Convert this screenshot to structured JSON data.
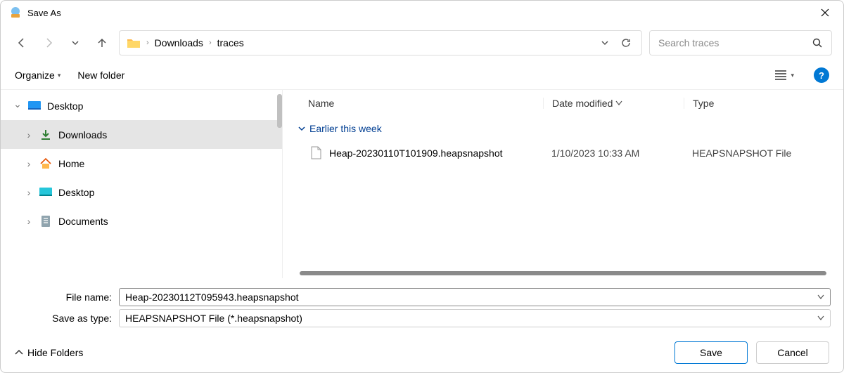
{
  "window": {
    "title": "Save As"
  },
  "nav": {
    "breadcrumbs": [
      "Downloads",
      "traces"
    ],
    "search_placeholder": "Search traces"
  },
  "toolbar": {
    "organize": "Organize",
    "new_folder": "New folder"
  },
  "sidebar": {
    "items": [
      {
        "label": "Desktop",
        "icon": "desktop-blue",
        "expanded": true,
        "level": 0
      },
      {
        "label": "Downloads",
        "icon": "download",
        "selected": true,
        "level": 1
      },
      {
        "label": "Home",
        "icon": "home",
        "level": 1
      },
      {
        "label": "Desktop",
        "icon": "desktop-cyan",
        "level": 1
      },
      {
        "label": "Documents",
        "icon": "document",
        "level": 1
      }
    ]
  },
  "filelist": {
    "columns": {
      "name": "Name",
      "date": "Date modified",
      "type": "Type"
    },
    "group": "Earlier this week",
    "files": [
      {
        "name": "Heap-20230110T101909.heapsnapshot",
        "date": "1/10/2023 10:33 AM",
        "type": "HEAPSNAPSHOT File"
      }
    ]
  },
  "inputs": {
    "filename_label": "File name:",
    "filename_value": "Heap-20230112T095943.heapsnapshot",
    "type_label": "Save as type:",
    "type_value": "HEAPSNAPSHOT File (*.heapsnapshot)"
  },
  "footer": {
    "hide_folders": "Hide Folders",
    "save": "Save",
    "cancel": "Cancel"
  }
}
